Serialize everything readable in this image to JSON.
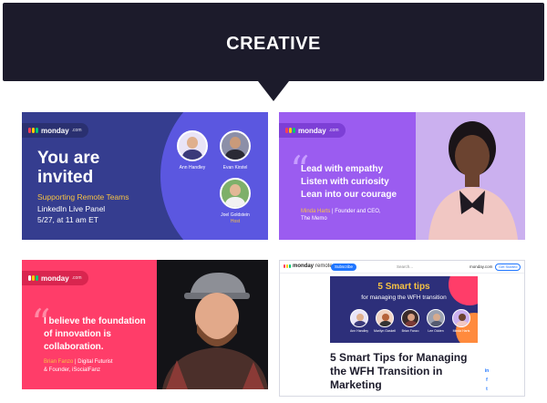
{
  "header": {
    "title": "CREATIVE"
  },
  "colors": {
    "banner": "#1c1b2b",
    "yellow": "#f6c343",
    "blue": "#1f76ff",
    "pink": "#ff3d69",
    "purple": "#9b5cf0"
  },
  "logo": {
    "name": "monday",
    "suffix": ".com"
  },
  "card1": {
    "headline_line1": "You are",
    "headline_line2": "invited",
    "subtitle": "Supporting Remote Teams",
    "line1": "LinkedIn Live Panel",
    "line2": "5/27, at 11 am ET",
    "panelists": [
      {
        "name": "Ann Handley",
        "role": ""
      },
      {
        "name": "Evan Kirstel",
        "role": ""
      },
      {
        "name": "Joel Goldstein",
        "role": "Host"
      }
    ]
  },
  "card2": {
    "quote_mark": "“",
    "lines": [
      "Lead with empathy",
      "Listen with curiosity",
      "Lean into our courage"
    ],
    "attribution_name": "Minda Harts",
    "attribution_rest": " | Founder and CEO,",
    "attribution_line2": "The Memo"
  },
  "card3": {
    "quote_mark": "“",
    "lines": [
      "I believe the foundation",
      "of innovation is",
      "collaboration."
    ],
    "attribution_name": "Brian Fanzo",
    "attribution_rest": " | Digital Futurist",
    "attribution_line2": "& Founder, iSocialFanz"
  },
  "card4": {
    "brand_a": "monday",
    "brand_b": "remote",
    "subscribe": "Subscribe",
    "search": "Search...",
    "site": "monday.com",
    "start": "Get Started",
    "hero_title": "5 Smart tips",
    "hero_subtitle": "for managing the WFH transition",
    "speakers": [
      "Ann Handley",
      "Marilyn Gaskell",
      "Brian Fanzo",
      "Lee Odden",
      "Minda Harts"
    ],
    "article_title": "5 Smart Tips for Managing the WFH Transition in Marketing",
    "social": [
      "in",
      "f",
      "t"
    ]
  }
}
